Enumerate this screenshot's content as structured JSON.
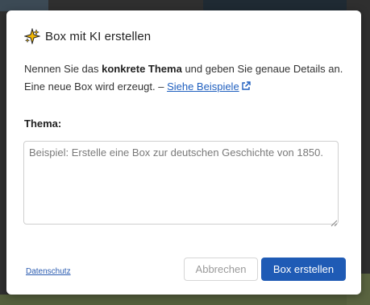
{
  "dialog": {
    "title": "Box mit KI erstellen",
    "icon": "sparkle-icon",
    "description_part1": "Nennen Sie das ",
    "description_bold": "konkrete Thema",
    "description_part2": " und geben Sie genaue Details an. Eine neue Box wird erzeugt. – ",
    "examples_link": "Siehe Beispiele",
    "field_label": "Thema:",
    "textarea_placeholder": "Beispiel: Erstelle eine Box zur deutschen Geschichte von 1850.",
    "textarea_value": "",
    "privacy_link": "Datenschutz",
    "cancel_label": "Abbrechen",
    "create_label": "Box erstellen"
  },
  "colors": {
    "accent": "#1f5bb5",
    "link": "#1f5fbf",
    "sparkle": "#f2b705"
  }
}
